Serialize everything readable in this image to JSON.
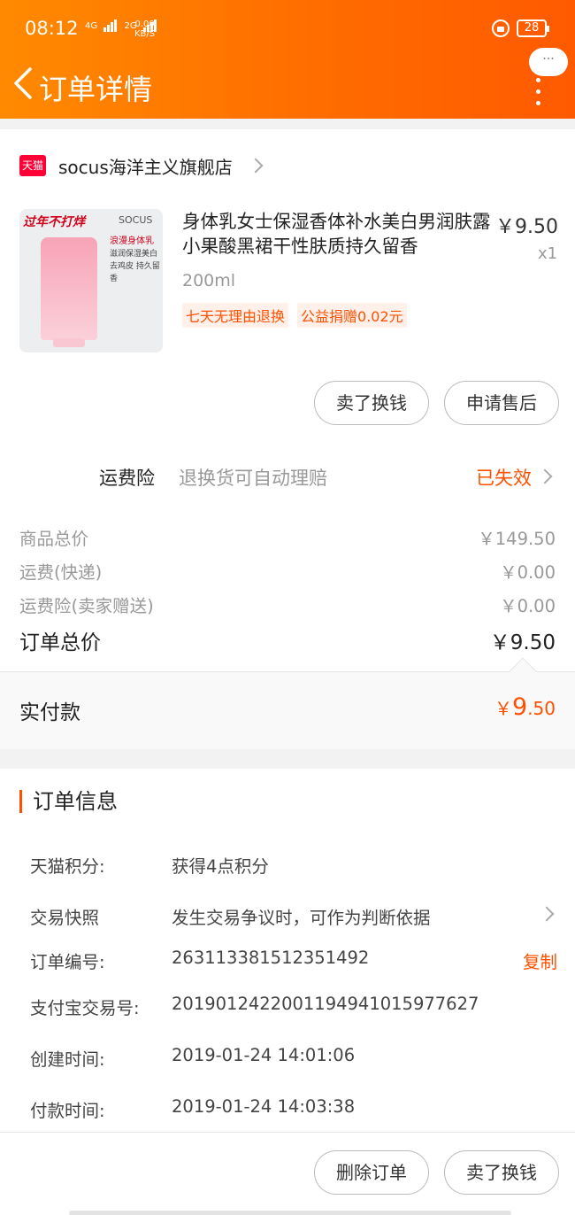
{
  "status": {
    "time": "08:12",
    "net_speed_top": "0.00",
    "net_speed_unit": "KB/S",
    "signal1": "4G",
    "signal2": "2G",
    "battery": "28"
  },
  "header": {
    "title": "订单详情",
    "more_label": "···"
  },
  "shop": {
    "badge": "天猫",
    "name": "socus海洋主义旗舰店"
  },
  "product": {
    "image_promo": "过年不打烊",
    "image_brand": "SOCUS",
    "image_lines": [
      "浪漫身体乳",
      "滋润保湿美白",
      "去鸡皮 持久留香"
    ],
    "title": "身体乳女士保湿香体补水美白男润肤露小果酸黑裙干性肤质持久留香",
    "price": "￥9.50",
    "qty": "x1",
    "sku": "200ml",
    "tags": [
      "七天无理由退换",
      "公益捐赠0.02元"
    ]
  },
  "actions": {
    "sell": "卖了换钱",
    "after_sale": "申请售后",
    "delete": "删除订单",
    "sell2": "卖了换钱"
  },
  "insurance": {
    "label": "运费险",
    "desc": "退换货可自动理赔",
    "status": "已失效"
  },
  "summary": {
    "goods_label": "商品总价",
    "goods_value": "￥149.50",
    "ship_label": "运费(快递)",
    "ship_value": "￥0.00",
    "ins_label": "运费险(卖家赠送)",
    "ins_value": "￥0.00",
    "total_label": "订单总价",
    "total_value": "￥9.50"
  },
  "paid": {
    "label": "实付款",
    "currency": "￥",
    "int": "9",
    "dec": ".50"
  },
  "order_info": {
    "title": "订单信息",
    "points_label": "天猫积分:",
    "points_value": "获得4点积分",
    "snapshot_label": "交易快照",
    "snapshot_value": "发生交易争议时，可作为判断依据",
    "order_no_label": "订单编号:",
    "order_no_value": "263113381512351492",
    "copy_label": "复制",
    "alipay_label": "支付宝交易号:",
    "alipay_value": "2019012422001194941015977627",
    "created_label": "创建时间:",
    "created_value": "2019-01-24 14:01:06",
    "paid_label": "付款时间:",
    "paid_value": "2019-01-24 14:03:38"
  },
  "colors": {
    "accent": "#ff5000",
    "header_start": "#ff8a00",
    "tmall_red": "#ff0036"
  }
}
